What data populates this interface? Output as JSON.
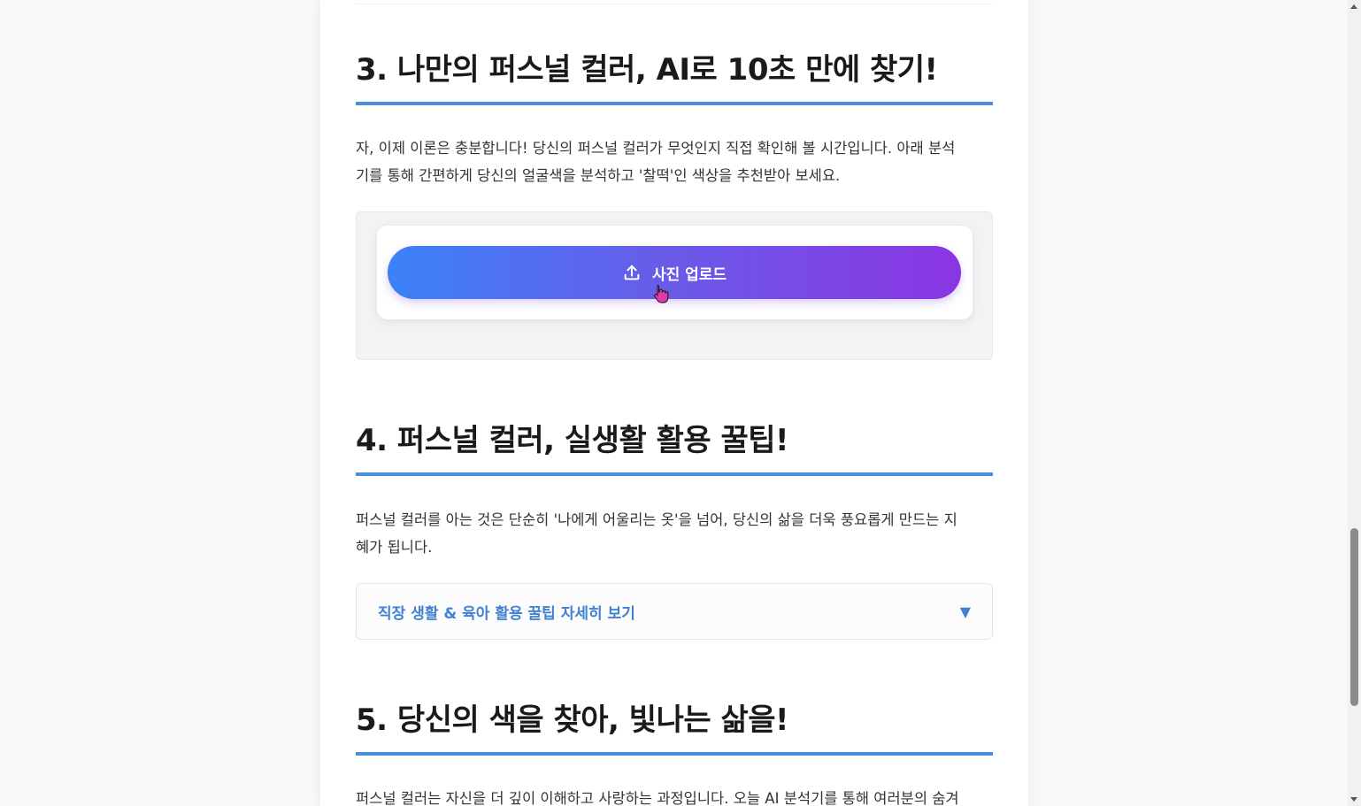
{
  "section3": {
    "heading": "3. 나만의 퍼스널 컬러, AI로 10초 만에 찾기!",
    "paragraph_line1": "자, 이제 이론은 충분합니다! 당신의 퍼스널 컬러가 무엇인지 직접 확인해 볼 시간입니다. 아래 분석",
    "paragraph_line2": "기를 통해 간편하게 당신의 얼굴색을 분석하고 '찰떡'인 색상을 추천받아 보세요.",
    "upload_button_label": "사진 업로드",
    "upload_icon": "upload-icon"
  },
  "section4": {
    "heading": "4. 퍼스널 컬러, 실생활 활용 꿀팁!",
    "paragraph_line1": "퍼스널 컬러를 아는 것은 단순히 '나에게 어울리는 옷'을 넘어, 당신의 삶을 더욱 풍요롭게 만드는 지",
    "paragraph_line2": "혜가 됩니다.",
    "details_label": "직장 생활 & 육아 활용 꿀팁 자세히 보기",
    "details_arrow": "▼"
  },
  "section5": {
    "heading": "5. 당신의 색을 찾아, 빛나는 삶을!",
    "paragraph_line1": "퍼스널 컬러는 자신을 더 깊이 이해하고 사랑하는 과정입니다. 오늘 AI 분석기를 통해 여러분의 숨겨"
  },
  "colors": {
    "accent_blue": "#4a8fdc",
    "gradient_start": "#3b82f6",
    "gradient_end": "#8b35e3"
  }
}
